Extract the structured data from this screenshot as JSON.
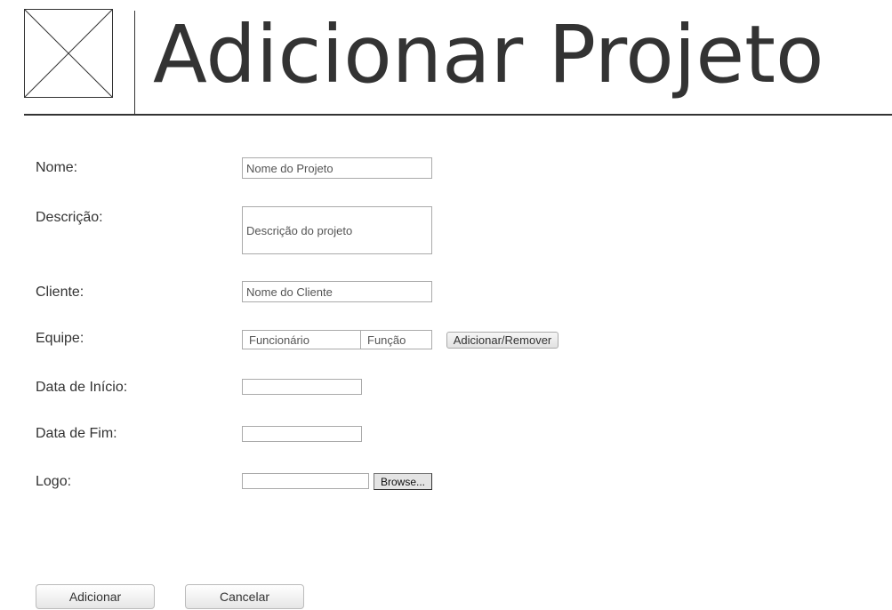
{
  "header": {
    "title": "Adicionar Projeto",
    "logo_icon": "image-placeholder-icon"
  },
  "form": {
    "nome": {
      "label": "Nome:",
      "placeholder": "Nome do Projeto",
      "value": ""
    },
    "descricao": {
      "label": "Descrição:",
      "placeholder": "Descrição do projeto"
    },
    "cliente": {
      "label": "Cliente:",
      "placeholder": "Nome do Cliente",
      "value": ""
    },
    "equipe": {
      "label": "Equipe:",
      "funcionario_placeholder": "Funcionário",
      "funcao_placeholder": "Função",
      "button_label": "Adicionar/Remover"
    },
    "data_inicio": {
      "label": "Data de Início:",
      "value": ""
    },
    "data_fim": {
      "label": "Data de Fim:",
      "value": ""
    },
    "logo": {
      "label": "Logo:",
      "value": "",
      "browse_label": "Browse..."
    }
  },
  "actions": {
    "add_label": "Adicionar",
    "cancel_label": "Cancelar"
  }
}
